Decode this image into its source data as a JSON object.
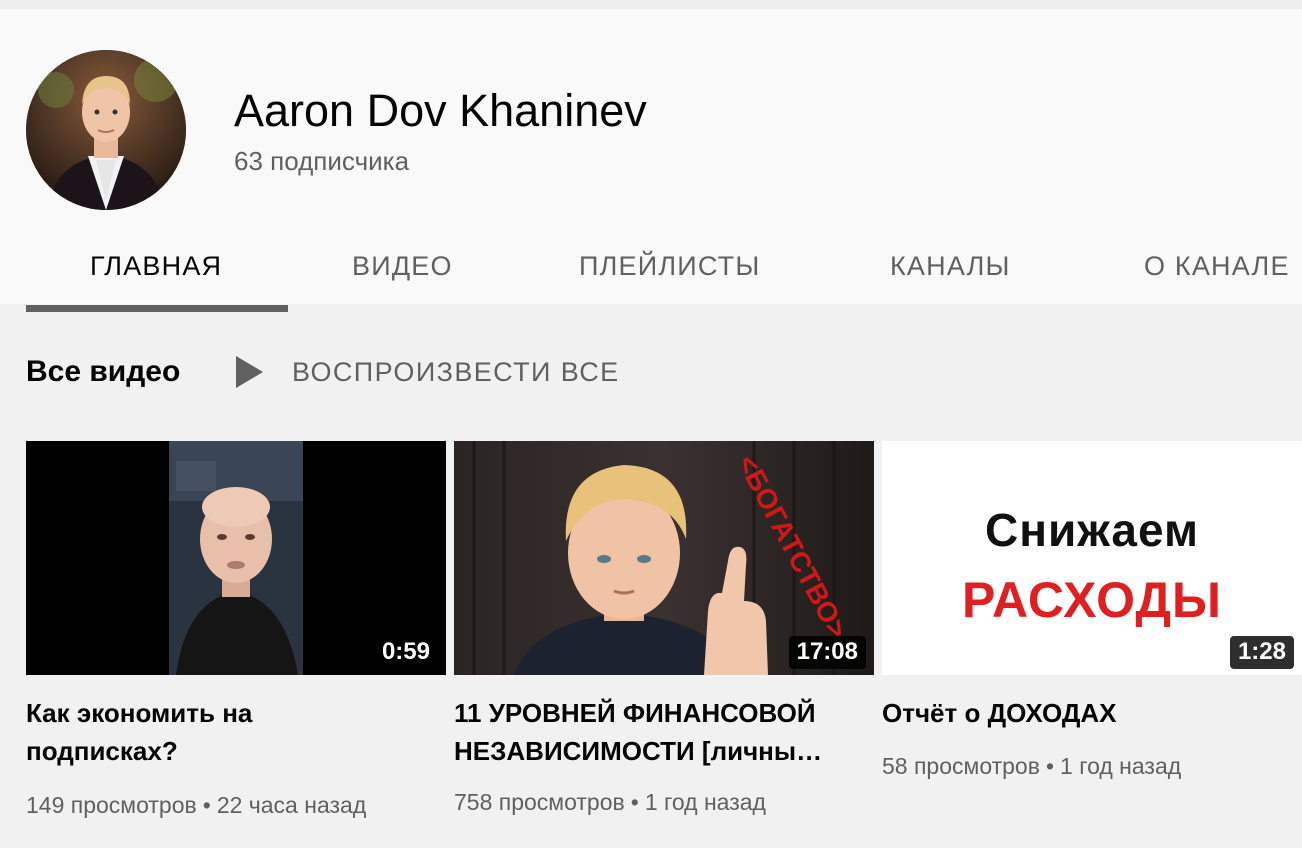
{
  "channel": {
    "name": "Aaron Dov Khaninev",
    "subscribers": "63 подписчика"
  },
  "tabs": [
    {
      "label": "ГЛАВНАЯ",
      "active": true
    },
    {
      "label": "ВИДЕО",
      "active": false
    },
    {
      "label": "ПЛЕЙЛИСТЫ",
      "active": false
    },
    {
      "label": "КАНАЛЫ",
      "active": false
    },
    {
      "label": "О КАНАЛЕ",
      "active": false
    }
  ],
  "section": {
    "title": "Все видео",
    "play_all_label": "ВОСПРОИЗВЕСТИ ВСЕ",
    "play_icon": "play-icon"
  },
  "videos": [
    {
      "title": "Как экономить на подписках?",
      "duration": "0:59",
      "views": "149 просмотров",
      "separator": "•",
      "age": "22 часа назад"
    },
    {
      "title": "11 УРОВНЕЙ ФИНАНСОВОЙ НЕЗАВИСИМОСТИ [личны…",
      "duration": "17:08",
      "views": "758 просмотров",
      "separator": "•",
      "age": "1 год назад",
      "thumb_caption": "<БОГАТСТВО>"
    },
    {
      "title": "Отчёт о ДОХОДАХ",
      "duration": "1:28",
      "views": "58 просмотров",
      "separator": "•",
      "age": "1 год назад",
      "thumb_line1": "Снижаем",
      "thumb_line2": "РАСХОДЫ"
    }
  ],
  "colors": {
    "header_bg": "#f9f9f9",
    "page_bg": "#f1f1f1",
    "primary_text": "#030303",
    "secondary_text": "#606060",
    "accent_red": "#e02020"
  }
}
